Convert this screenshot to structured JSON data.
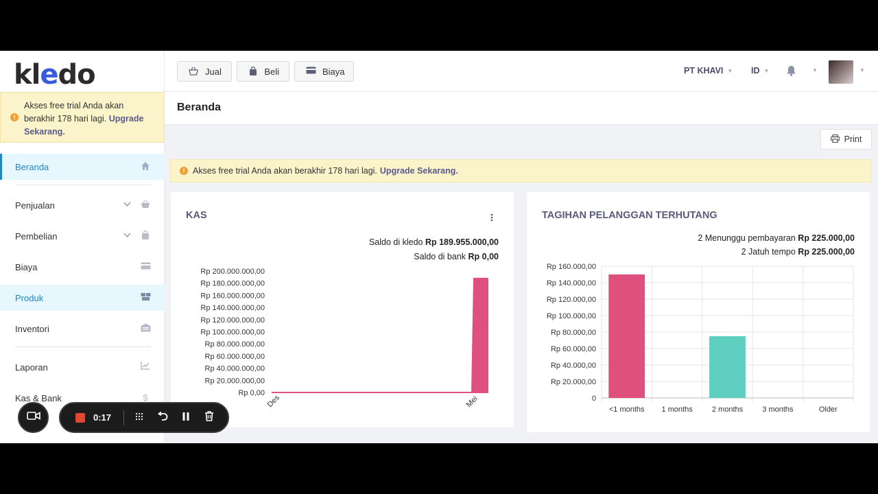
{
  "brand": {
    "logo_prefix": "kl",
    "logo_e": "e",
    "logo_suffix": "do"
  },
  "sidebar": {
    "trial_text": "Akses free trial Anda akan berakhir 178 hari lagi.",
    "trial_link": "Upgrade Sekarang.",
    "items": [
      {
        "label": "Beranda",
        "icon": "home-icon"
      },
      {
        "label": "Penjualan",
        "icon": "basket-icon"
      },
      {
        "label": "Pembelian",
        "icon": "bag-icon"
      },
      {
        "label": "Biaya",
        "icon": "card-icon"
      },
      {
        "label": "Produk",
        "icon": "boxes-icon"
      },
      {
        "label": "Inventori",
        "icon": "warehouse-icon"
      },
      {
        "label": "Laporan",
        "icon": "chart-icon"
      },
      {
        "label": "Kas & Bank",
        "icon": "dollar-icon"
      }
    ]
  },
  "topbar": {
    "jual": "Jual",
    "beli": "Beli",
    "biaya": "Biaya",
    "company": "PT KHAVI",
    "lang": "ID"
  },
  "page": {
    "title": "Beranda",
    "print": "Print"
  },
  "alert": {
    "text": "Akses free trial Anda akan berakhir 178 hari lagi.",
    "link": "Upgrade Sekarang."
  },
  "kas": {
    "title": "KAS",
    "saldo_kledo_label": "Saldo di kledo",
    "saldo_kledo_value": "Rp 189.955.000,00",
    "saldo_bank_label": "Saldo di bank",
    "saldo_bank_value": "Rp 0,00"
  },
  "tagihan": {
    "title": "TAGIHAN PELANGGAN TERHUTANG",
    "menunggu_label": "2 Menunggu pembayaran",
    "menunggu_value": "Rp 225.000,00",
    "jatuh_label": "2 Jatuh tempo",
    "jatuh_value": "Rp 225.000,00"
  },
  "recorder": {
    "time": "0:17",
    "stop_color": "#e0492f"
  },
  "colors": {
    "accent": "#1e88c8",
    "kas_line": "#e0507e",
    "bar_pink": "#e0507e",
    "bar_teal": "#5fcfc2"
  },
  "chart_data": [
    {
      "type": "area",
      "title": "KAS",
      "categories": [
        "Des",
        "Mei"
      ],
      "y_ticks": [
        "Rp 200.000.000,00",
        "Rp 180.000.000,00",
        "Rp 160.000.000,00",
        "Rp 140.000.000,00",
        "Rp 120.000.000,00",
        "Rp 100.000.000,00",
        "Rp 80.000.000,00",
        "Rp 60.000.000,00",
        "Rp 40.000.000,00",
        "Rp 20.000.000,00",
        "Rp 0,00"
      ],
      "ylim": [
        0,
        200000000
      ],
      "series": [
        {
          "values": [
            0,
            0,
            189955000
          ]
        }
      ],
      "grid": false
    },
    {
      "type": "bar",
      "title": "TAGIHAN PELANGGAN TERHUTANG",
      "categories": [
        "<1 months",
        "1 months",
        "2 months",
        "3 months",
        "Older"
      ],
      "values": [
        150000,
        0,
        75000,
        0,
        0
      ],
      "bar_colors": [
        "#e0507e",
        "#e0507e",
        "#5fcfc2",
        "#5fcfc2",
        "#5fcfc2"
      ],
      "y_ticks": [
        "Rp 160.000,00",
        "Rp 140.000,00",
        "Rp 120.000,00",
        "Rp 100.000,00",
        "Rp 80.000,00",
        "Rp 60.000,00",
        "Rp 40.000,00",
        "Rp 20.000,00",
        "0"
      ],
      "ylim": [
        0,
        160000
      ],
      "grid": true
    }
  ]
}
